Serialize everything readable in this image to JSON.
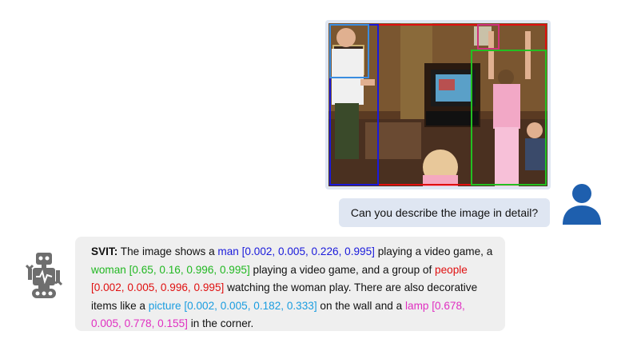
{
  "image": {
    "alt_icon": "photo-family-playing-video-game",
    "boxes": [
      {
        "name": "man",
        "color": "#1a1adb"
      },
      {
        "name": "woman",
        "color": "#22c022"
      },
      {
        "name": "people",
        "color": "#e01010"
      },
      {
        "name": "picture",
        "color": "#3a8de0"
      },
      {
        "name": "lamp",
        "color": "#d0307a"
      }
    ]
  },
  "user": {
    "message": "Can you describe the image in detail?",
    "avatar_icon": "user-icon",
    "avatar_color": "#1e5fae"
  },
  "assistant": {
    "avatar_icon": "robot-icon",
    "avatar_color": "#6e6e6e",
    "speaker": "SVIT:",
    "segments": [
      {
        "text": " The image shows a ",
        "cls": ""
      },
      {
        "text": "man [0.002, 0.005, 0.226, 0.995]",
        "cls": "c-blue"
      },
      {
        "text": " playing a video game, a ",
        "cls": ""
      },
      {
        "text": "woman [0.65, 0.16, 0.996, 0.995]",
        "cls": "c-green"
      },
      {
        "text": " playing a video game, and a group of ",
        "cls": ""
      },
      {
        "text": "people [0.002, 0.005, 0.996, 0.995]",
        "cls": "c-red"
      },
      {
        "text": " watching the woman play. There are also decorative items like a ",
        "cls": ""
      },
      {
        "text": "picture [0.002, 0.005, 0.182, 0.333]",
        "cls": "c-cyan"
      },
      {
        "text": " on the wall and a ",
        "cls": ""
      },
      {
        "text": "lamp [0.678, 0.005, 0.778, 0.155]",
        "cls": "c-pink"
      },
      {
        "text": " in the corner.",
        "cls": ""
      }
    ]
  }
}
